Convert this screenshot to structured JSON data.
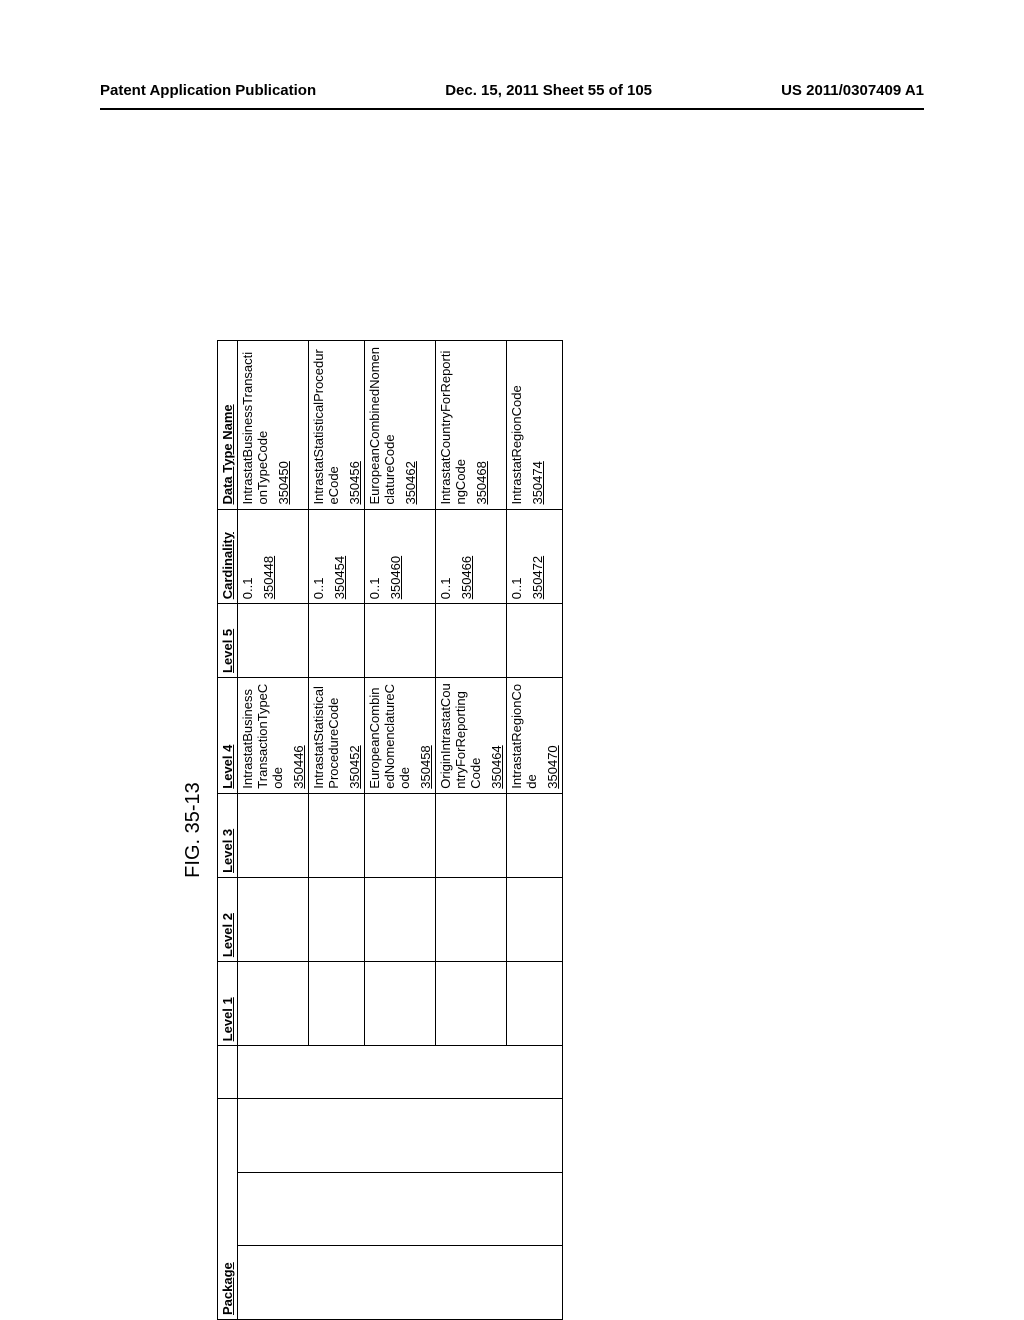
{
  "header": {
    "left": "Patent Application Publication",
    "center": "Dec. 15, 2011  Sheet 55 of 105",
    "right": "US 2011/0307409 A1"
  },
  "figure_title": "FIG. 35-13",
  "columns": [
    "Package",
    "",
    "",
    "",
    "Level 1",
    "Level 2",
    "Level 3",
    "Level 4",
    "Level 5",
    "Cardinality",
    "Data Type Name"
  ],
  "rows": [
    {
      "level4_text": "IntrastatBusinessTransactionTypeCode",
      "level4_ref": "350446",
      "cardinality_text": "0..1",
      "cardinality_ref": "350448",
      "datatype_text": "IntrastatBusinessTransactionTypeCode",
      "datatype_ref": "350450"
    },
    {
      "level4_text": "IntrastatStatisticalProcedureCode",
      "level4_ref": "350452",
      "cardinality_text": "0..1",
      "cardinality_ref": "350454",
      "datatype_text": "IntrastatStatisticalProcedureCode",
      "datatype_ref": "350456"
    },
    {
      "level4_text": "EuropeanCombinedNomenclatureCode",
      "level4_ref": "350458",
      "cardinality_text": "0..1",
      "cardinality_ref": "350460",
      "datatype_text": "EuropeanCombinedNomenclatureCode",
      "datatype_ref": "350462"
    },
    {
      "level4_text": "OriginIntrastatCountryForReportingCode",
      "level4_ref": "350464",
      "cardinality_text": "0..1",
      "cardinality_ref": "350466",
      "datatype_text": "IntrastatCountryForReportingCode",
      "datatype_ref": "350468"
    },
    {
      "level4_text": "IntrastatRegionCode",
      "level4_ref": "350470",
      "cardinality_text": "0..1",
      "cardinality_ref": "350472",
      "datatype_text": "IntrastatRegionCode",
      "datatype_ref": "350474"
    }
  ]
}
